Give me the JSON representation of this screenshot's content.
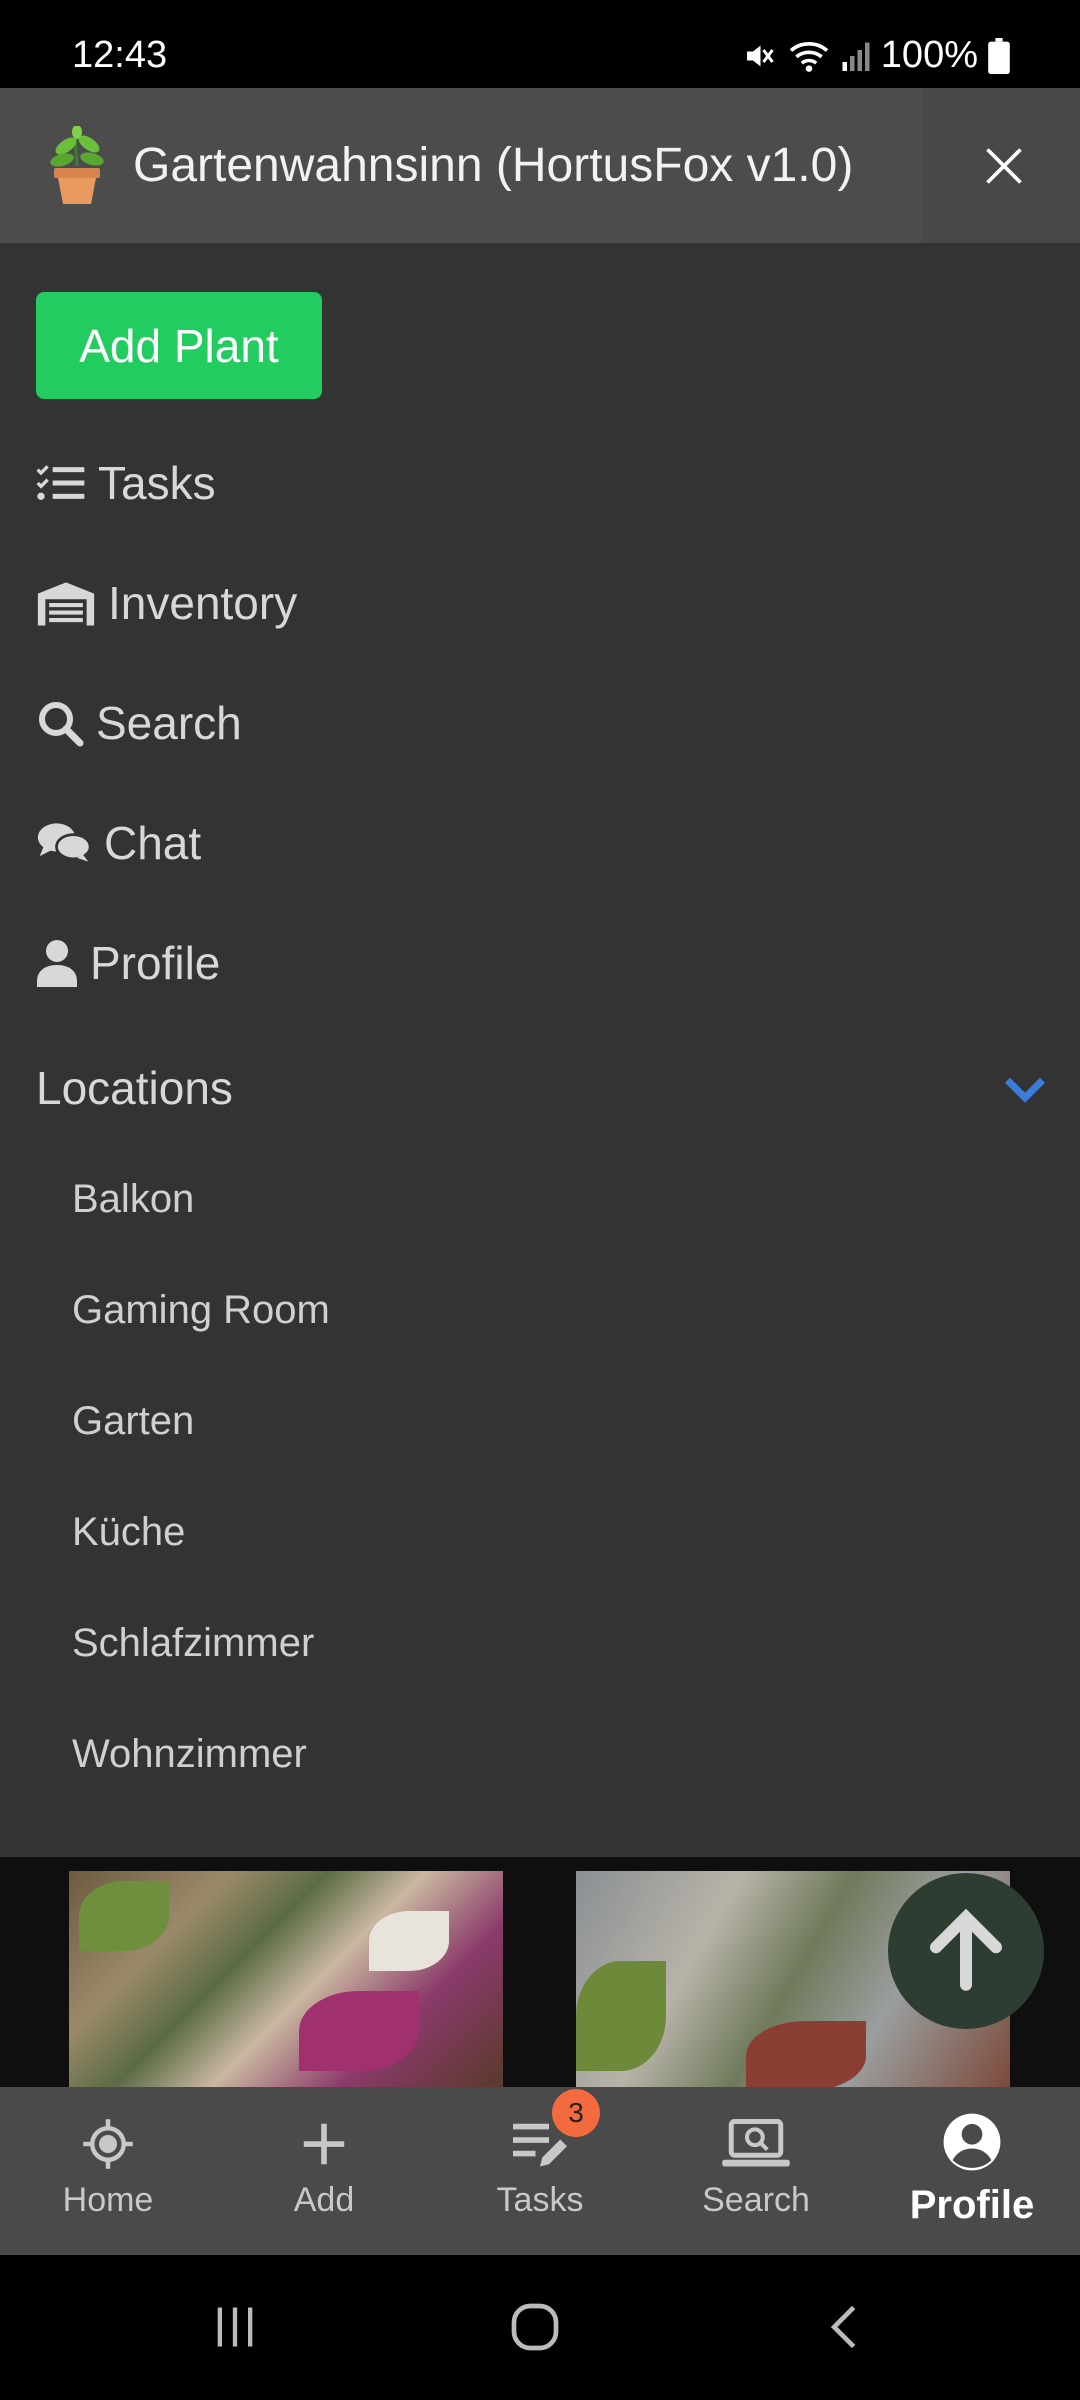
{
  "status_bar": {
    "time": "12:43",
    "battery": "100%"
  },
  "header": {
    "title": "Gartenwahnsinn (HortusFox v1.0)"
  },
  "drawer": {
    "add_plant_label": "Add Plant",
    "menu": [
      {
        "label": "Tasks",
        "icon": "tasks-list-icon"
      },
      {
        "label": "Inventory",
        "icon": "warehouse-icon"
      },
      {
        "label": "Search",
        "icon": "search-icon"
      },
      {
        "label": "Chat",
        "icon": "chat-bubbles-icon"
      },
      {
        "label": "Profile",
        "icon": "user-icon"
      }
    ],
    "locations_label": "Locations",
    "locations": [
      "Balkon",
      "Gaming Room",
      "Garten",
      "Küche",
      "Schlafzimmer",
      "Wohnzimmer"
    ]
  },
  "bottom_nav": {
    "items": [
      {
        "label": "Home",
        "icon": "home-target-icon"
      },
      {
        "label": "Add",
        "icon": "plus-icon"
      },
      {
        "label": "Tasks",
        "icon": "tasks-edit-icon"
      },
      {
        "label": "Search",
        "icon": "laptop-search-icon"
      },
      {
        "label": "Profile",
        "icon": "account-circle-icon"
      }
    ],
    "tasks_badge": "3",
    "active": "Profile"
  },
  "colors": {
    "accent_green": "#23cc60",
    "chevron_blue": "#3b7ddd",
    "badge_orange": "#f26a3d",
    "drawer_bg": "#333333"
  }
}
